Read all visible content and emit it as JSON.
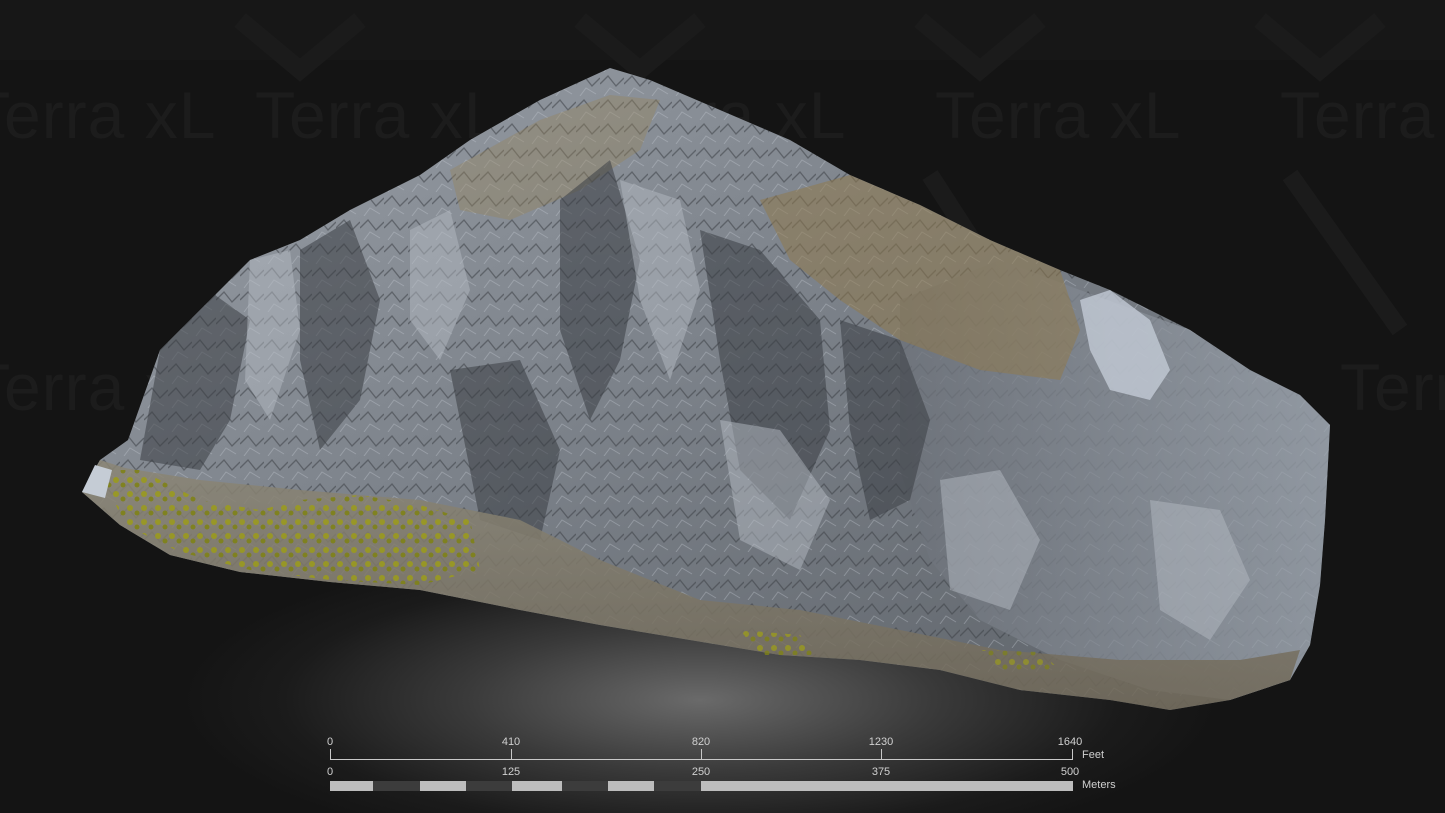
{
  "watermark": {
    "text": "Terra xL"
  },
  "scale_bar": {
    "feet": {
      "unit": "Feet",
      "ticks": [
        "0",
        "410",
        "820",
        "1230",
        "1640"
      ]
    },
    "meters": {
      "unit": "Meters",
      "ticks": [
        "0",
        "125",
        "250",
        "375",
        "500"
      ]
    },
    "colors": {
      "light_segment": "#bdbdbd",
      "dark_segment": "#3c3c3c",
      "line": "#c8c8c8"
    }
  },
  "terrain": {
    "rock_color": "#8a8f96",
    "shadow_color": "#3e4248",
    "vegetation_color": "#8a8a1c",
    "dry_grass_color": "#8f7a4e"
  }
}
